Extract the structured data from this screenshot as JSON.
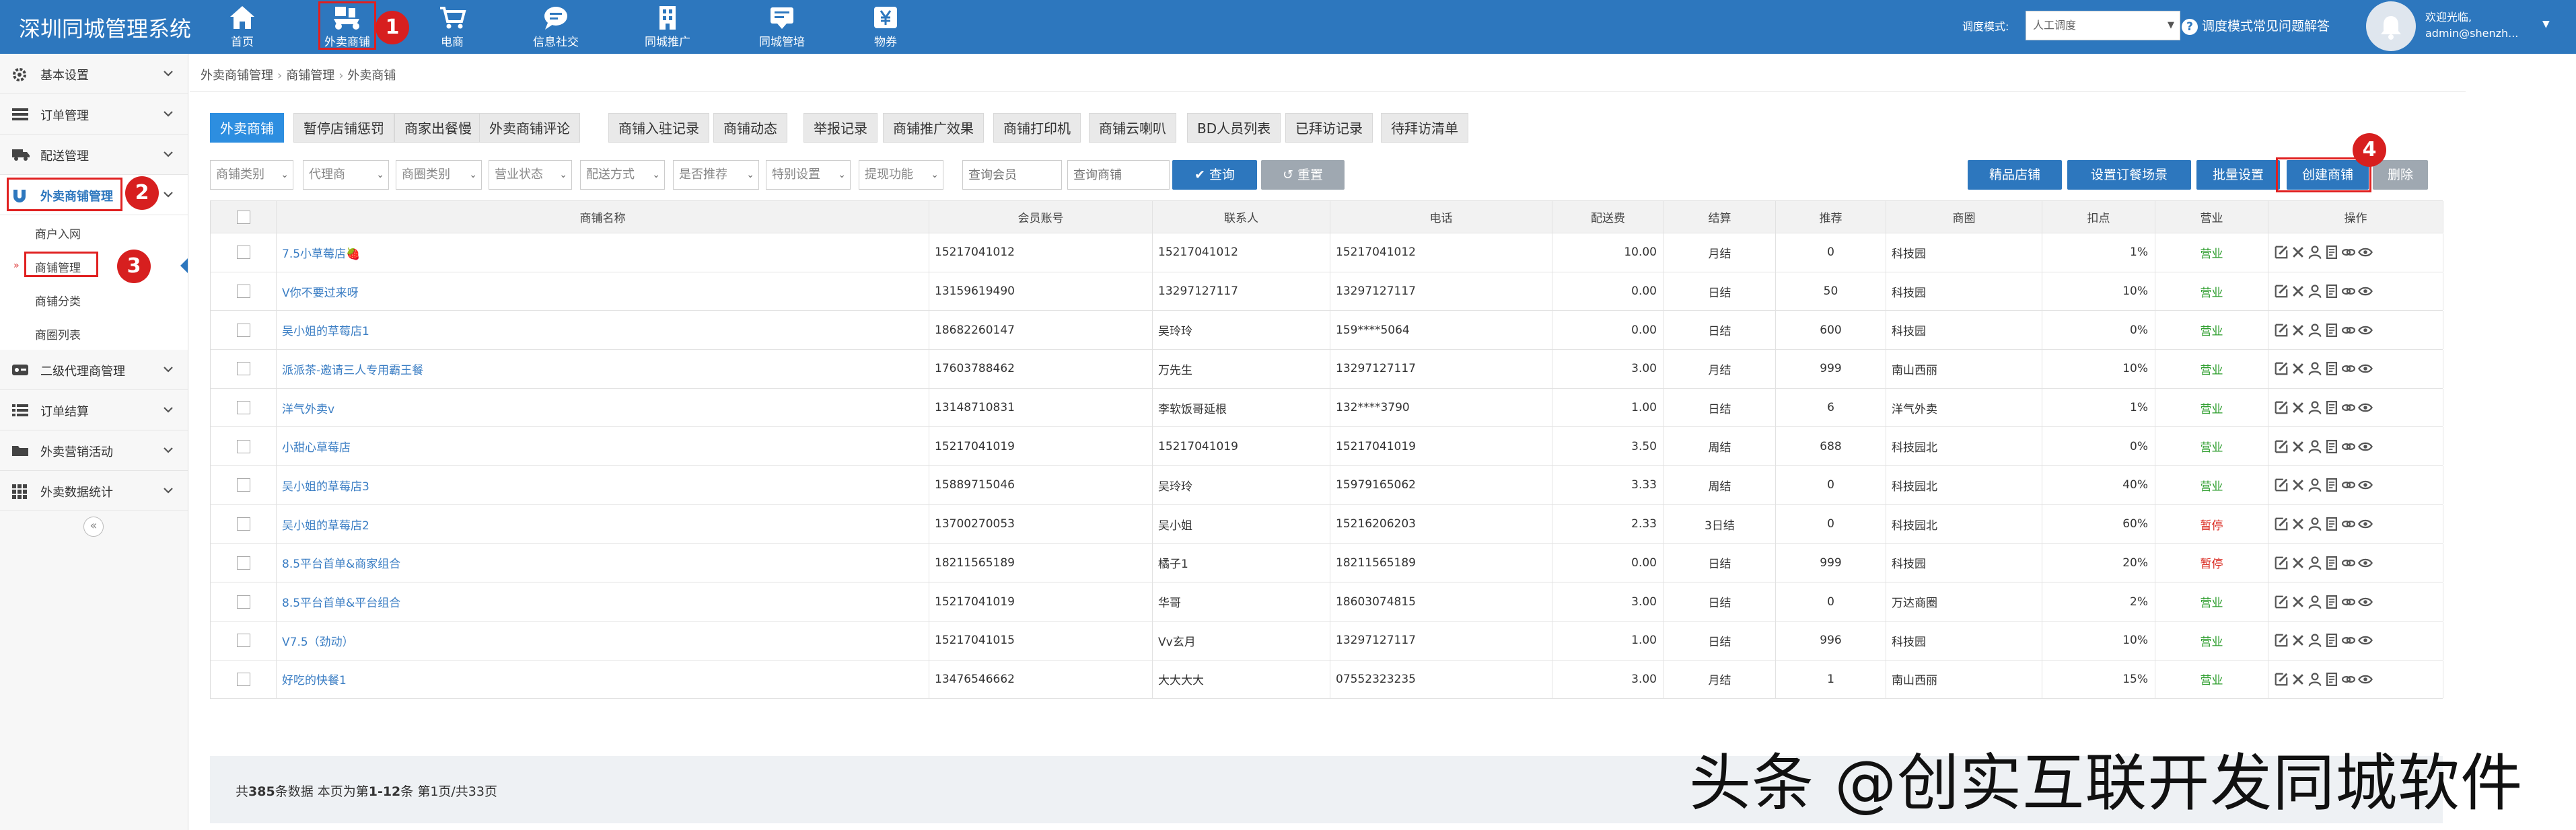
{
  "app": {
    "title": "深圳同城管理系统"
  },
  "topnav": [
    {
      "label": "首页",
      "icon": "home-icon"
    },
    {
      "label": "外卖商铺",
      "icon": "scooter-icon"
    },
    {
      "label": "电商",
      "icon": "cart-icon"
    },
    {
      "label": "信息社交",
      "icon": "chat-icon"
    },
    {
      "label": "同城推广",
      "icon": "building-icon"
    },
    {
      "label": "同城管培",
      "icon": "message-icon"
    },
    {
      "label": "物券",
      "icon": "yen-icon"
    }
  ],
  "header_right": {
    "mode_label": "调度模式:",
    "mode_value": "人工调度",
    "help_text": "调度模式常见问题解答",
    "welcome": "欢迎光临,",
    "user": "admin@shenzh..."
  },
  "markers": [
    "1",
    "2",
    "3",
    "4"
  ],
  "sidebar": {
    "groups": [
      {
        "label": "基本设置",
        "icon": "gear-icon"
      },
      {
        "label": "订单管理",
        "icon": "list-icon"
      },
      {
        "label": "配送管理",
        "icon": "truck-icon"
      },
      {
        "label": "外卖商铺管理",
        "icon": "magnet-icon"
      },
      {
        "label": "二级代理商管理",
        "icon": "card-icon"
      },
      {
        "label": "订单结算",
        "icon": "list-icon"
      },
      {
        "label": "外卖营销活动",
        "icon": "folder-icon"
      },
      {
        "label": "外卖数据统计",
        "icon": "grid-icon"
      }
    ],
    "subitems": [
      "商户入网",
      "商铺管理",
      "商铺分类",
      "商圈列表"
    ],
    "collapse": "«"
  },
  "breadcrumb": [
    "外卖商铺管理",
    "商铺管理",
    "外卖商铺"
  ],
  "tabs": [
    "外卖商铺",
    "暂停店铺惩罚",
    "商家出餐慢",
    "外卖商铺评论",
    "商铺入驻记录",
    "商铺动态",
    "举报记录",
    "商铺推广效果",
    "商铺打印机",
    "商铺云喇叭",
    "BD人员列表",
    "已拜访记录",
    "待拜访清单"
  ],
  "filters": [
    "商铺类别",
    "代理商",
    "商圈类别",
    "营业状态",
    "配送方式",
    "是否推荐",
    "特别设置",
    "提现功能"
  ],
  "search": {
    "member_placeholder": "查询会员",
    "shop_placeholder": "查询商铺",
    "query_btn": "查询",
    "reset_btn": "重置"
  },
  "actions": [
    "精品店铺",
    "设置订餐场景",
    "批量设置",
    "创建商铺",
    "删除"
  ],
  "table": {
    "columns": [
      "",
      "商铺名称",
      "会员账号",
      "联系人",
      "电话",
      "配送费",
      "结算",
      "推荐",
      "商圈",
      "扣点",
      "营业",
      "操作"
    ],
    "rows": [
      [
        "7.5小草莓店🍓",
        "15217041012",
        "15217041012",
        "15217041012",
        "10.00",
        "月结",
        "0",
        "科技园",
        "1%",
        "营业"
      ],
      [
        "V你不要过来呀",
        "13159619490",
        "13297127117",
        "13297127117",
        "0.00",
        "日结",
        "50",
        "科技园",
        "10%",
        "营业"
      ],
      [
        "吴小姐的草莓店1",
        "18682260147",
        "吴玲玲",
        "159****5064",
        "0.00",
        "日结",
        "600",
        "科技园",
        "0%",
        "营业"
      ],
      [
        "派派茶-邀请三人专用霸王餐",
        "17603788462",
        "万先生",
        "13297127117",
        "3.00",
        "月结",
        "999",
        "南山西丽",
        "10%",
        "营业"
      ],
      [
        "洋气外卖v",
        "13148710831",
        "李软饭哥延根",
        "132****3790",
        "1.00",
        "日结",
        "6",
        "洋气外卖",
        "1%",
        "营业"
      ],
      [
        "小甜心草莓店",
        "15217041019",
        "15217041019",
        "15217041019",
        "3.50",
        "周结",
        "688",
        "科技园北",
        "0%",
        "营业"
      ],
      [
        "吴小姐的草莓店3",
        "15889715046",
        "吴玲玲",
        "15979165062",
        "3.33",
        "周结",
        "0",
        "科技园北",
        "40%",
        "营业"
      ],
      [
        "吴小姐的草莓店2",
        "13700270053",
        "吴小姐",
        "15216206203",
        "2.33",
        "3日结",
        "0",
        "科技园北",
        "60%",
        "暂停"
      ],
      [
        "8.5平台首单&商家组合",
        "18211565189",
        "橘子1",
        "18211565189",
        "0.00",
        "日结",
        "999",
        "科技园",
        "20%",
        "暂停"
      ],
      [
        "8.5平台首单&平台组合",
        "15217041019",
        "华哥",
        "18603074815",
        "3.00",
        "日结",
        "0",
        "万达商圈",
        "2%",
        "营业"
      ],
      [
        "V7.5（劲动）",
        "15217041015",
        "Vv玄月",
        "13297127117",
        "1.00",
        "日结",
        "996",
        "科技园",
        "10%",
        "营业"
      ],
      [
        "好吃的快餐1",
        "13476546662",
        "大大大大",
        "07552323235",
        "3.00",
        "月结",
        "1",
        "南山西丽",
        "15%",
        "营业"
      ]
    ]
  },
  "footer": {
    "prefix": "共",
    "total": "385",
    "mid": "条数据  本页为第",
    "range": "1-12",
    "suffix": "条  第1页/共33页"
  },
  "watermark": "头条 @创实互联开发同城软件"
}
